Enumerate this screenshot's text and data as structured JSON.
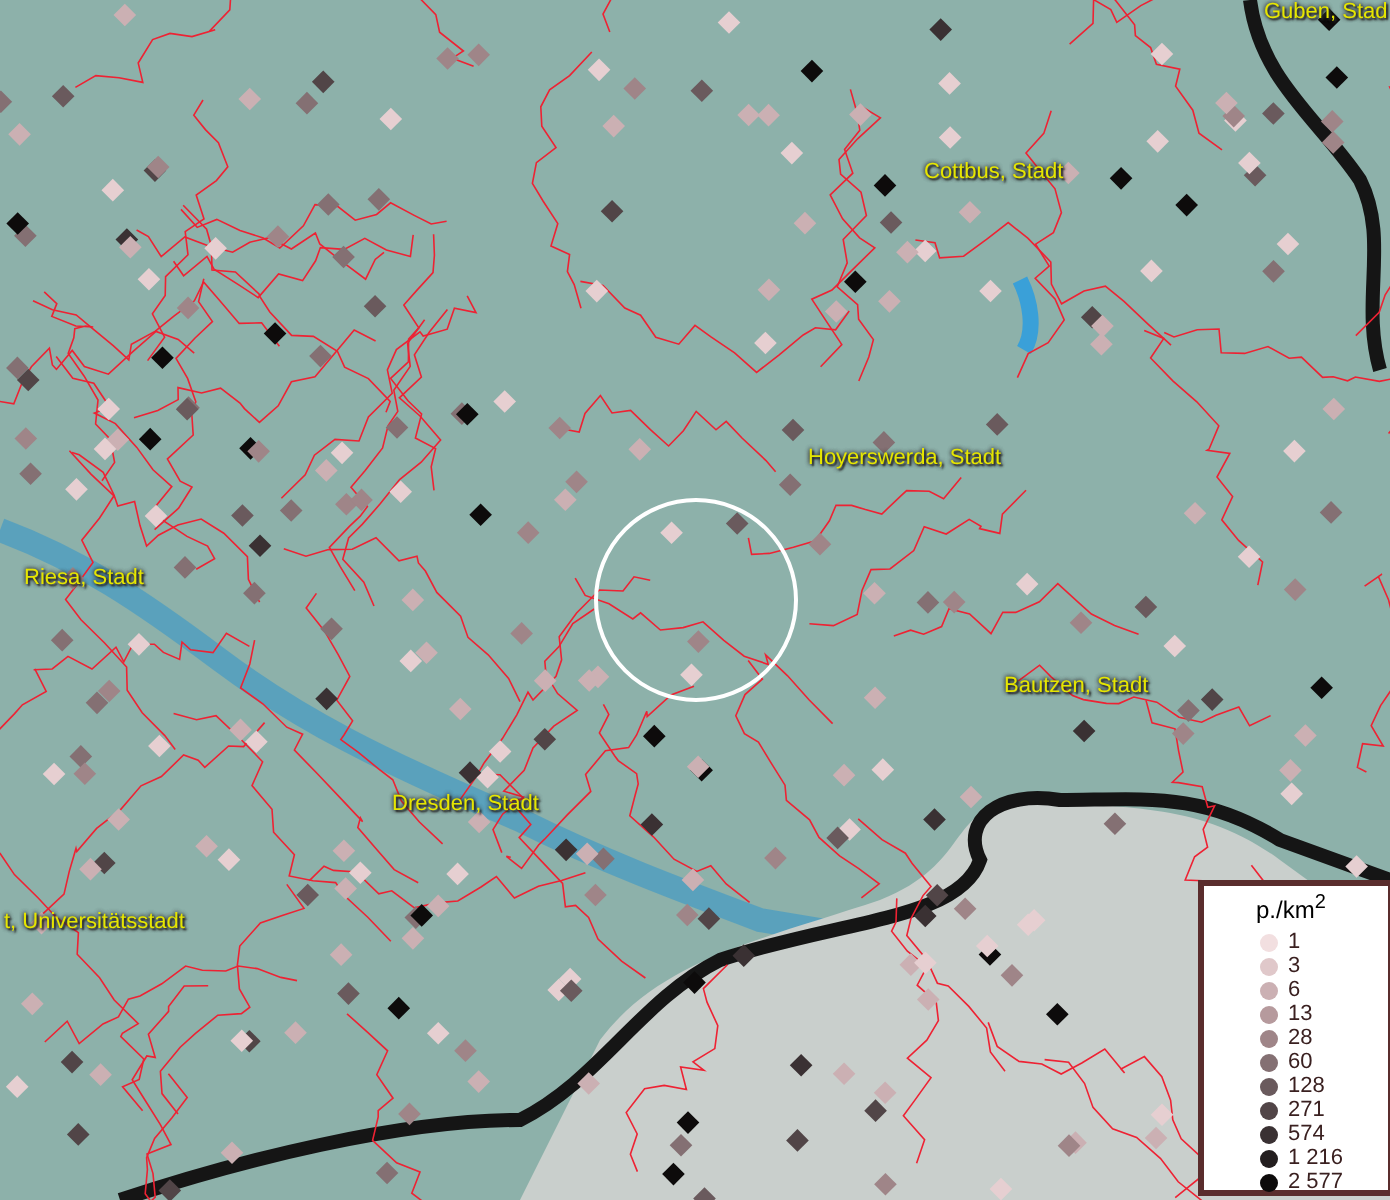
{
  "map": {
    "place_labels": [
      {
        "name": "Guben, Stad"
      },
      {
        "name": "Cottbus, Stadt"
      },
      {
        "name": "Hoyerswerda, Stadt"
      },
      {
        "name": "Riesa, Stadt"
      },
      {
        "name": "Bautzen, Stadt"
      },
      {
        "name": "Dresden, Stadt"
      },
      {
        "name": "t, Universitätsstadt"
      }
    ]
  },
  "legend": {
    "title": "p./km$^{2}$",
    "items": [
      {
        "label": "1",
        "color": "#f2dfe0"
      },
      {
        "label": "3",
        "color": "#e0c8ca"
      },
      {
        "label": "6",
        "color": "#cbb0b3"
      },
      {
        "label": "13",
        "color": "#b69a9d"
      },
      {
        "label": "28",
        "color": "#9f8588"
      },
      {
        "label": "60",
        "color": "#847073"
      },
      {
        "label": "128",
        "color": "#6a5a5d"
      },
      {
        "label": "271",
        "color": "#514547"
      },
      {
        "label": "574",
        "color": "#3a3133"
      },
      {
        "label": "1 216",
        "color": "#231e1f"
      },
      {
        "label": "2 577",
        "color": "#0d0b0b"
      }
    ]
  }
}
